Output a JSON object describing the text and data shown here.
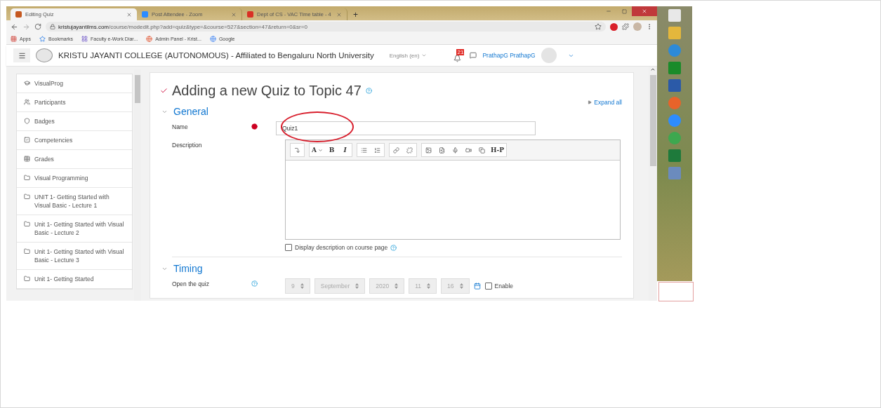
{
  "browser": {
    "tabs": [
      {
        "title": "Editing Quiz",
        "selected": true
      },
      {
        "title": "Post Attendee - Zoom",
        "selected": false
      },
      {
        "title": "Dept of CS - VAC Time table - 4",
        "selected": false
      }
    ],
    "new_tab": "+",
    "url_host": "kristujayantilms.com",
    "url_path": "/course/modedit.php?add=quiz&type=&course=527&section=47&return=0&sr=0",
    "bookmarks": [
      "Apps",
      "Bookmarks",
      "Faculty e-Work Diar...",
      "Admin Panel - Krist...",
      "Google"
    ]
  },
  "navbar": {
    "site_title": "KRISTU JAYANTI COLLEGE (AUTONOMOUS) - Affiliated to Bengaluru North University",
    "language": "English (en)",
    "notification_count": "21",
    "user_name": "PrathapG PrathapG"
  },
  "sidebar": {
    "items": [
      {
        "kind": "course",
        "label": "VisualProg"
      },
      {
        "kind": "participants",
        "label": "Participants"
      },
      {
        "kind": "badges",
        "label": "Badges"
      },
      {
        "kind": "competencies",
        "label": "Competencies"
      },
      {
        "kind": "grades",
        "label": "Grades"
      },
      {
        "kind": "section",
        "label": "Visual Programming"
      },
      {
        "kind": "section",
        "label": "UNIT 1- Getting Started with Visual Basic - Lecture 1"
      },
      {
        "kind": "section",
        "label": "Unit 1- Getting Started with Visual Basic - Lecture 2"
      },
      {
        "kind": "section",
        "label": "Unit 1- Getting Started with Visual Basic - Lecture 3"
      },
      {
        "kind": "section",
        "label": "Unit 1- Getting Started"
      }
    ]
  },
  "form": {
    "heading": "Adding a new Quiz to Topic 47",
    "expand_all": "Expand all",
    "general": {
      "title": "General",
      "expanded": true,
      "name_label": "Name",
      "name_value": "Quiz1",
      "description_label": "Description",
      "toolbar": [
        [
          {
            "kind": "expand"
          }
        ],
        [
          {
            "kind": "font",
            "label": "A"
          },
          {
            "kind": "bold",
            "label": "B"
          },
          {
            "kind": "italic",
            "label": "I"
          }
        ],
        [
          {
            "kind": "bullets"
          },
          {
            "kind": "numbers"
          }
        ],
        [
          {
            "kind": "link"
          },
          {
            "kind": "unlink"
          }
        ],
        [
          {
            "kind": "image"
          },
          {
            "kind": "media"
          },
          {
            "kind": "audio"
          },
          {
            "kind": "video"
          },
          {
            "kind": "files"
          },
          {
            "kind": "h5p",
            "label": "H-P"
          }
        ]
      ],
      "display_checkbox": {
        "label": "Display description on course page",
        "checked": false
      }
    },
    "timing": {
      "title": "Timing",
      "expanded": true,
      "open_label": "Open the quiz",
      "disabled": true,
      "date_fields": [
        "9",
        "September",
        "2020",
        "11",
        "16"
      ],
      "enable": {
        "label": "Enable",
        "checked": false
      }
    }
  }
}
